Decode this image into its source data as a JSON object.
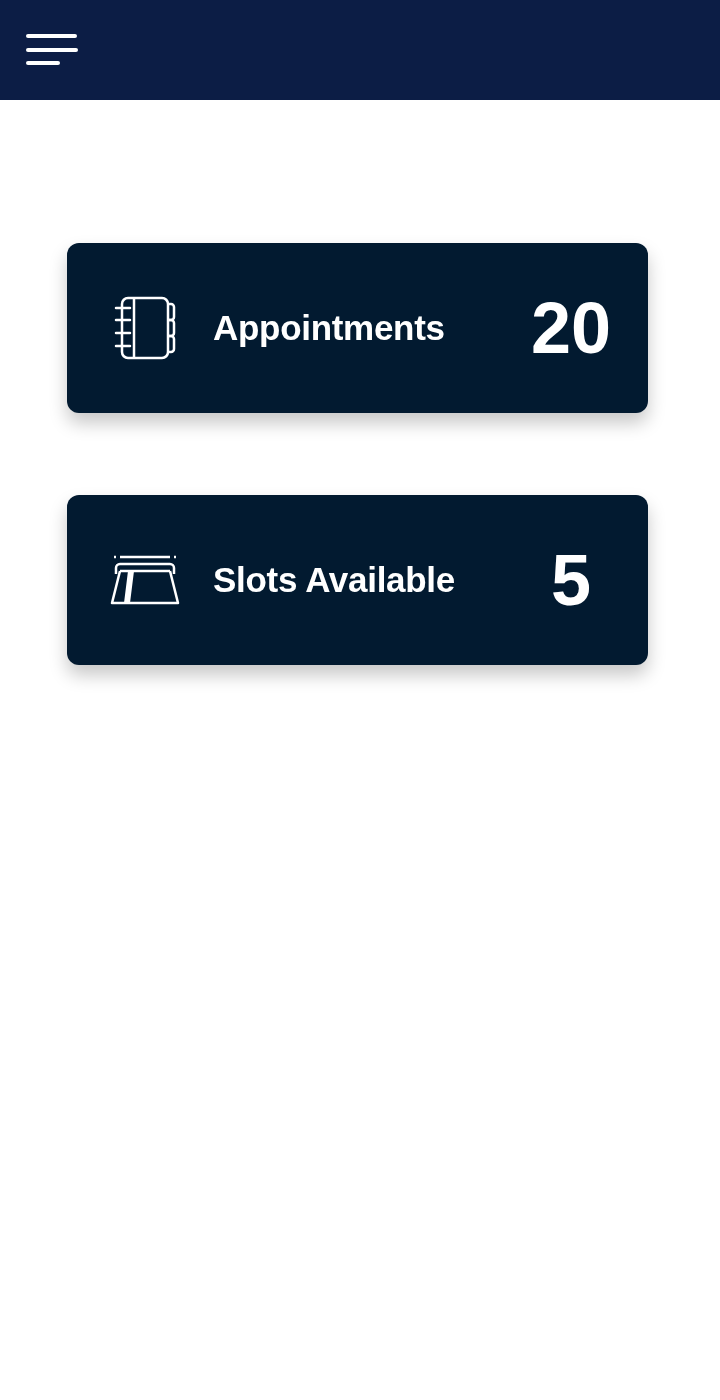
{
  "cards": [
    {
      "label": "Appointments",
      "value": "20"
    },
    {
      "label": "Slots Available",
      "value": "5"
    }
  ]
}
